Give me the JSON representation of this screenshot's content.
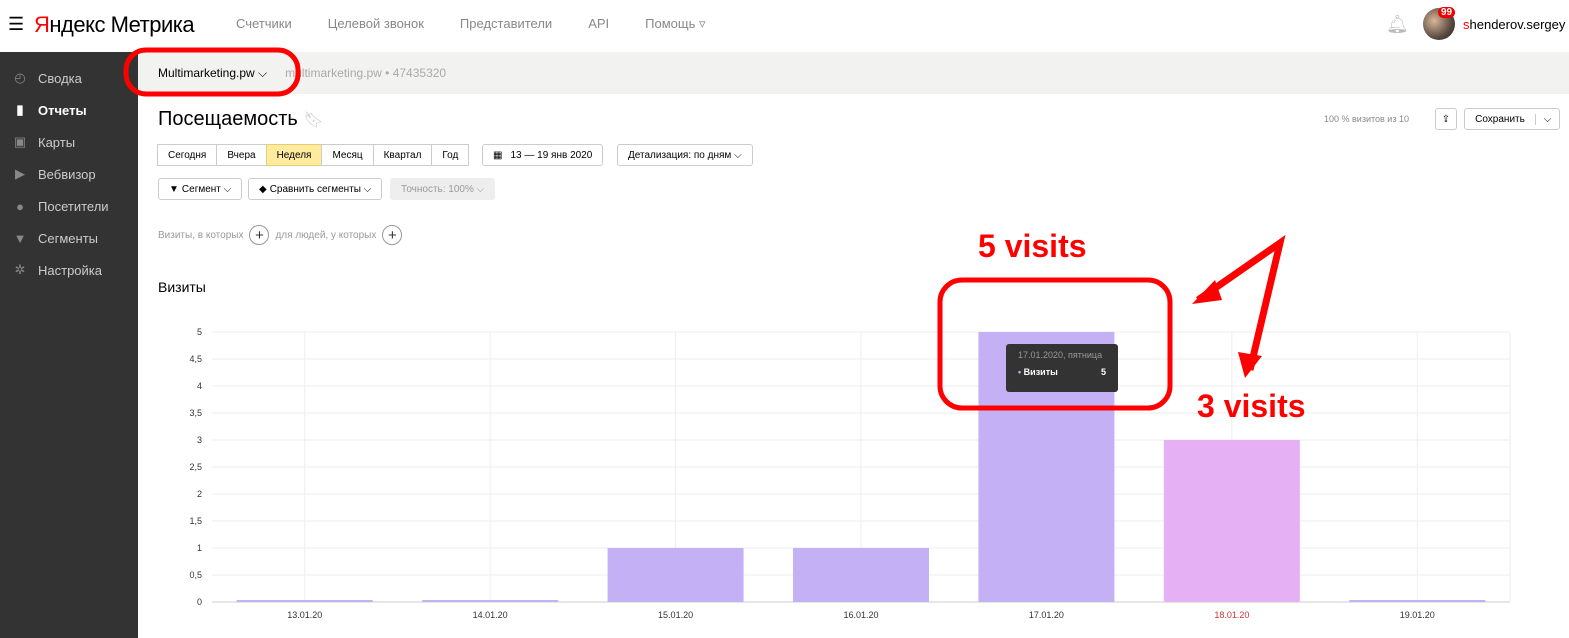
{
  "header": {
    "logo_red": "Я",
    "logo_rest": "ндекс Метрика",
    "nav": [
      "Счетчики",
      "Целевой звонок",
      "Представители",
      "API",
      "Помощь ▿"
    ],
    "badge": "99",
    "user_first": "s",
    "user_rest": "henderov.sergey"
  },
  "sidebar": [
    {
      "icon": "gauge-icon",
      "glyph": "◴",
      "label": "Сводка"
    },
    {
      "icon": "bars-icon",
      "glyph": "▮",
      "label": "Отчеты"
    },
    {
      "icon": "map-icon",
      "glyph": "▣",
      "label": "Карты"
    },
    {
      "icon": "play-icon",
      "glyph": "▶",
      "label": "Вебвизор"
    },
    {
      "icon": "person-icon",
      "glyph": "●",
      "label": "Посетители"
    },
    {
      "icon": "funnel-icon",
      "glyph": "▼",
      "label": "Сегменты"
    },
    {
      "icon": "gear-icon",
      "glyph": "✲",
      "label": "Настройка"
    }
  ],
  "crumb": {
    "counter": "Multimarketing.pw ⌵",
    "sub": "multimarketing.pw • 47435320"
  },
  "page": {
    "title": "Посещаемость",
    "periods": [
      "Сегодня",
      "Вчера",
      "Неделя",
      "Месяц",
      "Квартал",
      "Год"
    ],
    "dates": "13 — 19 янв 2020",
    "detail": "Детализация: по дням ⌵",
    "segment": "Сегмент ⌵",
    "compare": "Сравнить сегменты ⌵",
    "accuracy": "Точность: 100% ⌵",
    "cond1": "Визиты, в которых",
    "cond2": "для людей, у которых",
    "visits_share": "100 % визитов из 10",
    "save": "Сохранить",
    "chart_title": "Визиты"
  },
  "tooltip": {
    "date": "17.01.2020, пятница",
    "label": "Визиты",
    "value": "5"
  },
  "annotations": {
    "a1": "5 visits",
    "a2": "3 visits"
  },
  "colors": {
    "bar": "#c4b0f5",
    "bar_hover": "#e6b0f5",
    "annot": "#ff0000"
  },
  "chart_data": {
    "type": "bar",
    "title": "Визиты",
    "categories": [
      "13.01.20",
      "14.01.20",
      "15.01.20",
      "16.01.20",
      "17.01.20",
      "18.01.20",
      "19.01.20"
    ],
    "values": [
      0,
      0,
      1,
      1,
      5,
      3,
      0
    ],
    "ylim": [
      0,
      5
    ],
    "yticks": [
      "0",
      "0,5",
      "1",
      "1,5",
      "2",
      "2,5",
      "3",
      "3,5",
      "4",
      "4,5",
      "5"
    ],
    "grid": true
  }
}
